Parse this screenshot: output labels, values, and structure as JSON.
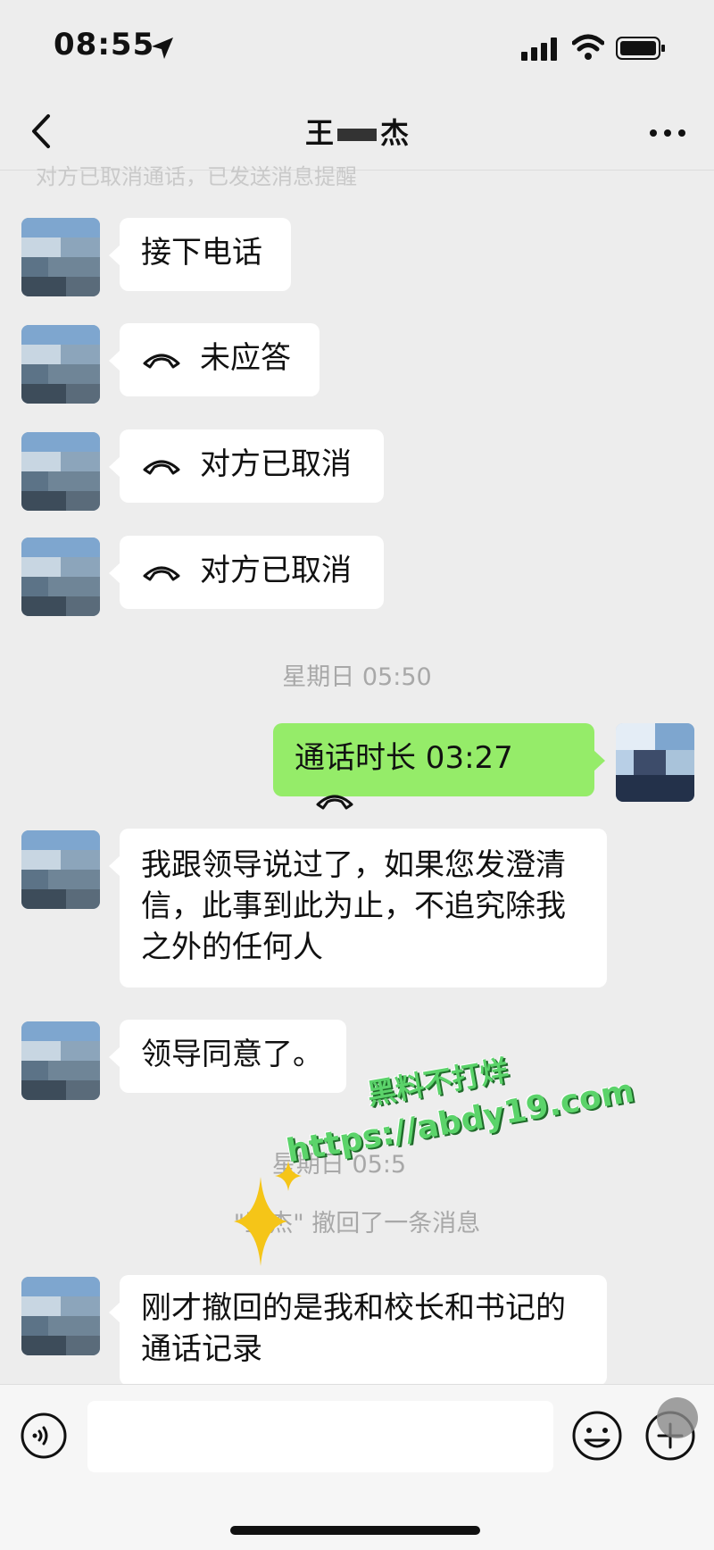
{
  "status_bar": {
    "time": "08:55"
  },
  "header": {
    "title_left": "王",
    "title_right": "杰",
    "faded_text": "对方已取消通话，已发送消息提醒"
  },
  "messages": [
    {
      "text": "接下电话"
    },
    {
      "text": "未应答"
    },
    {
      "text": "对方已取消"
    },
    {
      "text": "对方已取消"
    }
  ],
  "timestamp_1": "星期日 05:50",
  "outgoing_call": {
    "text": "通话时长 03:27"
  },
  "messages_2": [
    {
      "text": "我跟领导说过了，如果您发澄清信，此事到此为止，不追究除我之外的任何人"
    },
    {
      "text": "领导同意了。"
    }
  ],
  "timestamp_2": "星期日 05:5",
  "system_notice": "\"王杰\" 撤回了一条消息",
  "messages_3": [
    {
      "text": "刚才撤回的是我和校长和书记的通话记录"
    }
  ],
  "watermark": {
    "line1": "黑料不打烊",
    "line2": "https://abdy19.com"
  },
  "avatar_colors": [
    "#7ea6cf",
    "#a9c3da",
    "#5c7387",
    "#3d4c5a",
    "#c8d6e2"
  ]
}
